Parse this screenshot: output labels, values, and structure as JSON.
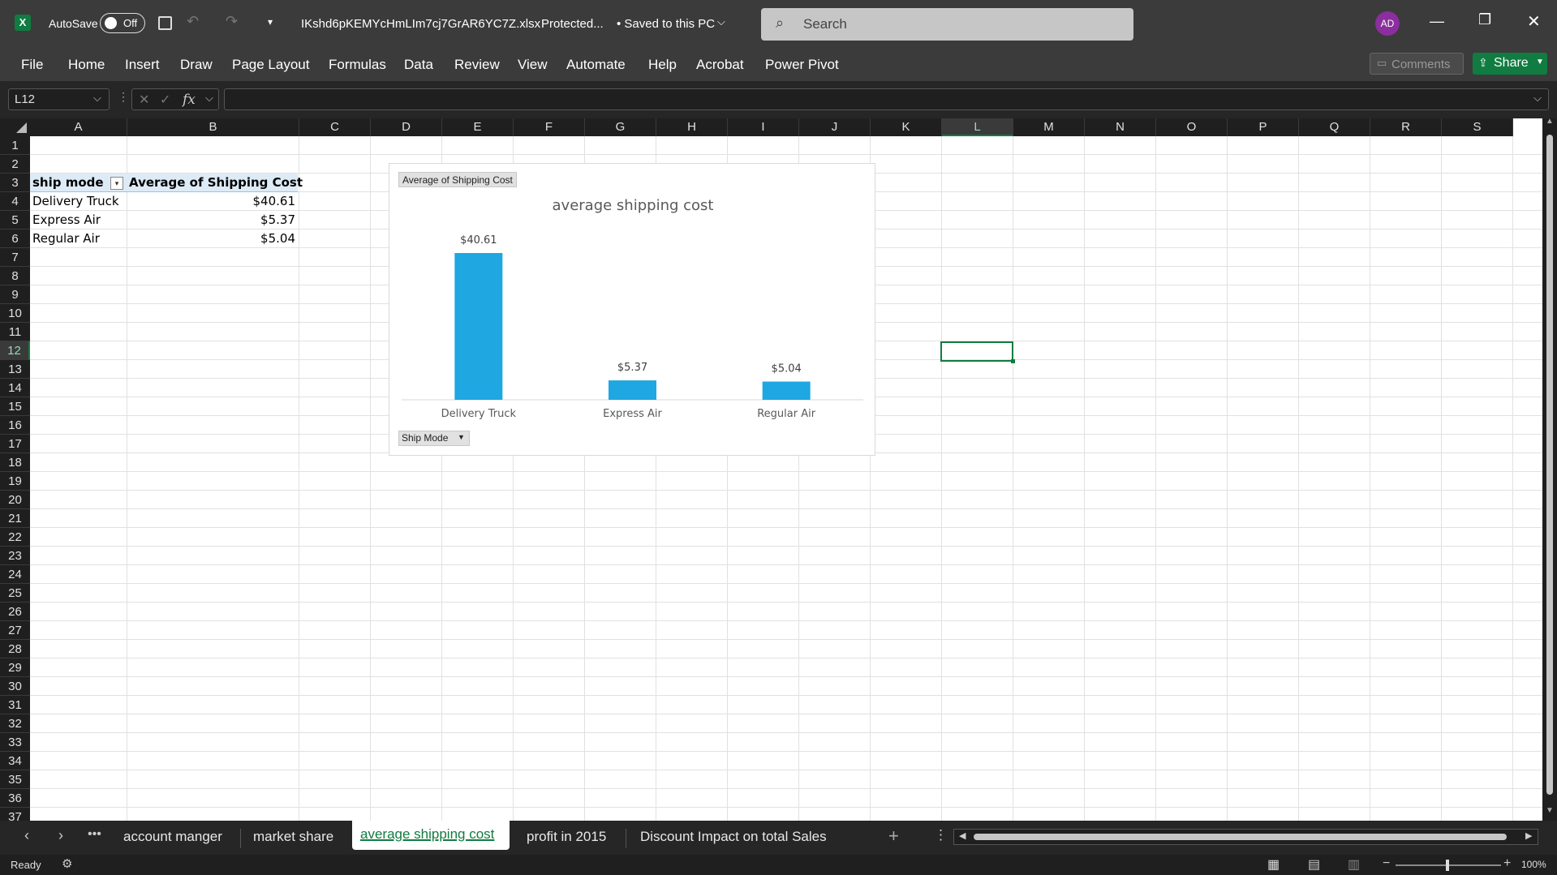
{
  "titlebar": {
    "autosave_label": "AutoSave",
    "autosave_state": "Off",
    "filename": "IKshd6pKEMYcHmLIm7cj7GrAR6YC7Z.xlsx",
    "protected": "Protected...",
    "saved_status": "• Saved to this PC",
    "search_placeholder": "Search",
    "avatar_initials": "AD"
  },
  "ribbon": {
    "menu": [
      "File",
      "Home",
      "Insert",
      "Draw",
      "Page Layout",
      "Formulas",
      "Data",
      "Review",
      "View",
      "Automate",
      "Help",
      "Acrobat",
      "Power Pivot"
    ],
    "comments_label": "Comments",
    "share_label": "Share"
  },
  "formula_bar": {
    "name_box": "L12",
    "fx": "fx",
    "formula_value": ""
  },
  "columns": [
    "A",
    "B",
    "C",
    "D",
    "E",
    "F",
    "G",
    "H",
    "I",
    "J",
    "K",
    "L",
    "M",
    "N",
    "O",
    "P",
    "Q",
    "R",
    "S"
  ],
  "rows": [
    "1",
    "2",
    "3",
    "4",
    "5",
    "6",
    "7",
    "8",
    "9",
    "10",
    "11",
    "12",
    "13",
    "14",
    "15",
    "16",
    "17",
    "18",
    "19",
    "20",
    "21",
    "22",
    "23",
    "24",
    "25",
    "26",
    "27",
    "28",
    "29",
    "30",
    "31",
    "32",
    "33",
    "34",
    "35",
    "36",
    "37"
  ],
  "pivot_table": {
    "header_a": "ship mode",
    "header_b": "Average of Shipping Cost",
    "rows": [
      {
        "mode": "Delivery Truck",
        "cost": "$40.61"
      },
      {
        "mode": "Express Air",
        "cost": "$5.37"
      },
      {
        "mode": "Regular Air",
        "cost": "$5.04"
      }
    ]
  },
  "chart": {
    "field_button": "Average of Shipping Cost",
    "axis_field_button": "Ship Mode",
    "bar_color": "#1ea7e1"
  },
  "chart_data": {
    "type": "bar",
    "title": "average shipping cost",
    "categories": [
      "Delivery Truck",
      "Express Air",
      "Regular Air"
    ],
    "values": [
      40.61,
      5.37,
      5.04
    ],
    "data_labels": [
      "$40.61",
      "$5.37",
      "$5.04"
    ],
    "xlabel": "",
    "ylabel": "",
    "grid": false,
    "legend": "none"
  },
  "sheet_tabs": {
    "tabs": [
      "account manger",
      "market share",
      "average shipping cost",
      "profit in 2015",
      "Discount Impact on total Sales"
    ],
    "active": "average shipping cost"
  },
  "status": {
    "ready": "Ready",
    "zoom": "100%"
  },
  "colors": {
    "accent_green": "#107c41",
    "title_bg": "#3b3b3b",
    "avatar_bg": "#8a2f9d"
  }
}
